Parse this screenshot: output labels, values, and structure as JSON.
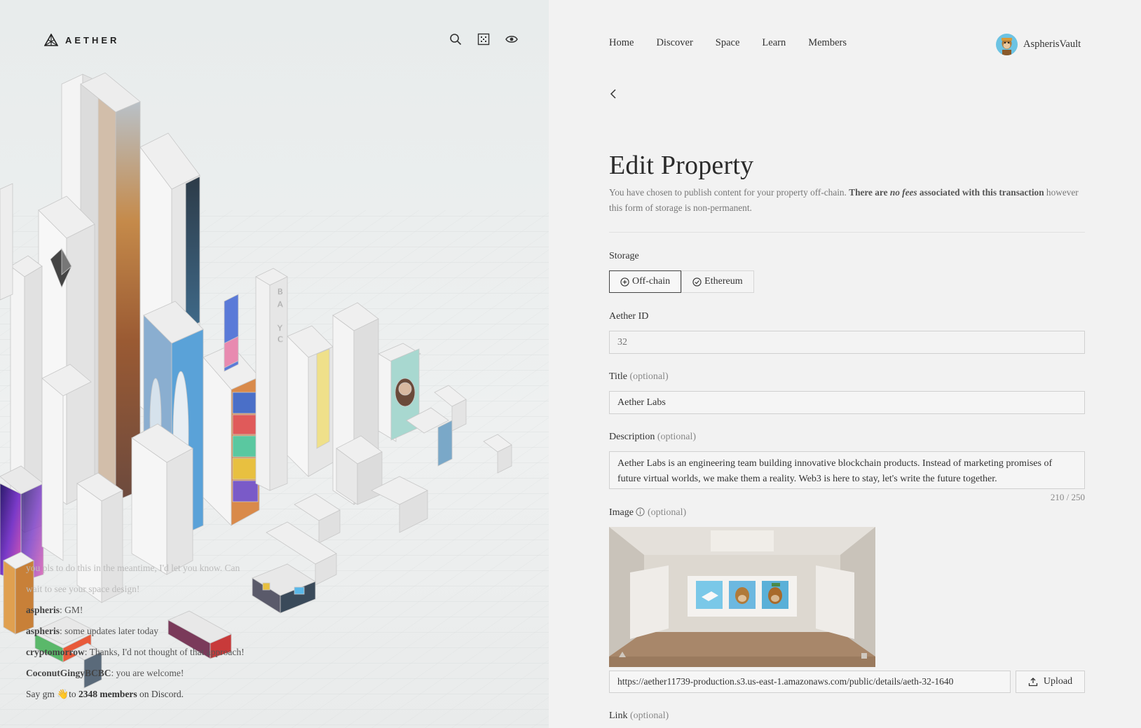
{
  "brand": {
    "name": "AETHER"
  },
  "left_icons": [
    "search-icon",
    "map-grid-icon",
    "eye-icon"
  ],
  "chat": {
    "messages": [
      {
        "user": "",
        "text": "you pls to do this in the meantime, I'd let you know. Can",
        "style": "faded"
      },
      {
        "user": "",
        "text": "wait to see your space design!",
        "style": "faded"
      },
      {
        "user": "aspheris",
        "text": ": GM!",
        "style": "normal"
      },
      {
        "user": "aspheris",
        "text": ": some updates later today",
        "style": "normal"
      },
      {
        "user": "cryptomorrow",
        "text": ": Thanks, I'd not thought of that approach!",
        "style": "normal"
      },
      {
        "user": "CoconutGingyBCBC",
        "text": ": you are welcome!",
        "style": "normal"
      }
    ],
    "discord": {
      "prefix": "Say gm",
      "emoji": "👋",
      "mid": "to",
      "count": "2348 members",
      "suffix": "on Discord."
    }
  },
  "nav": {
    "items": [
      "Home",
      "Discover",
      "Space",
      "Learn",
      "Members"
    ],
    "user_name": "AspherisVault"
  },
  "page": {
    "title": "Edit Property",
    "intro_text": "You have chosen to publish content for your property off-chain.",
    "intro_bold_1": "There are",
    "intro_em": "no fees",
    "intro_bold_2": "associated with this transaction",
    "intro_tail": "however this form of storage is non-permanent."
  },
  "form": {
    "storage": {
      "label": "Storage",
      "options": [
        {
          "label": "Off-chain",
          "icon": "plus-circle-icon",
          "active": true
        },
        {
          "label": "Ethereum",
          "icon": "check-circle-icon",
          "active": false
        }
      ]
    },
    "aether_id": {
      "label": "Aether ID",
      "placeholder": "32"
    },
    "title": {
      "label": "Title",
      "optional": "(optional)",
      "value": "Aether Labs"
    },
    "description": {
      "label": "Description",
      "optional": "(optional)",
      "value": "Aether Labs is an engineering team building innovative blockchain products. Instead of marketing promises of future virtual worlds, we make them a reality. Web3 is here to stay, let's write the future together.",
      "counter": "210 / 250"
    },
    "image": {
      "label": "Image",
      "optional": "(optional)",
      "url": "https://aether11739-production.s3.us-east-1.amazonaws.com/public/details/aeth-32-1640",
      "upload_label": "Upload"
    },
    "link": {
      "label": "Link",
      "optional": "(optional)"
    }
  },
  "colors": {
    "accent": "#444444",
    "background": "#f2f2f2",
    "sky_blue": "#6cc3e3"
  }
}
